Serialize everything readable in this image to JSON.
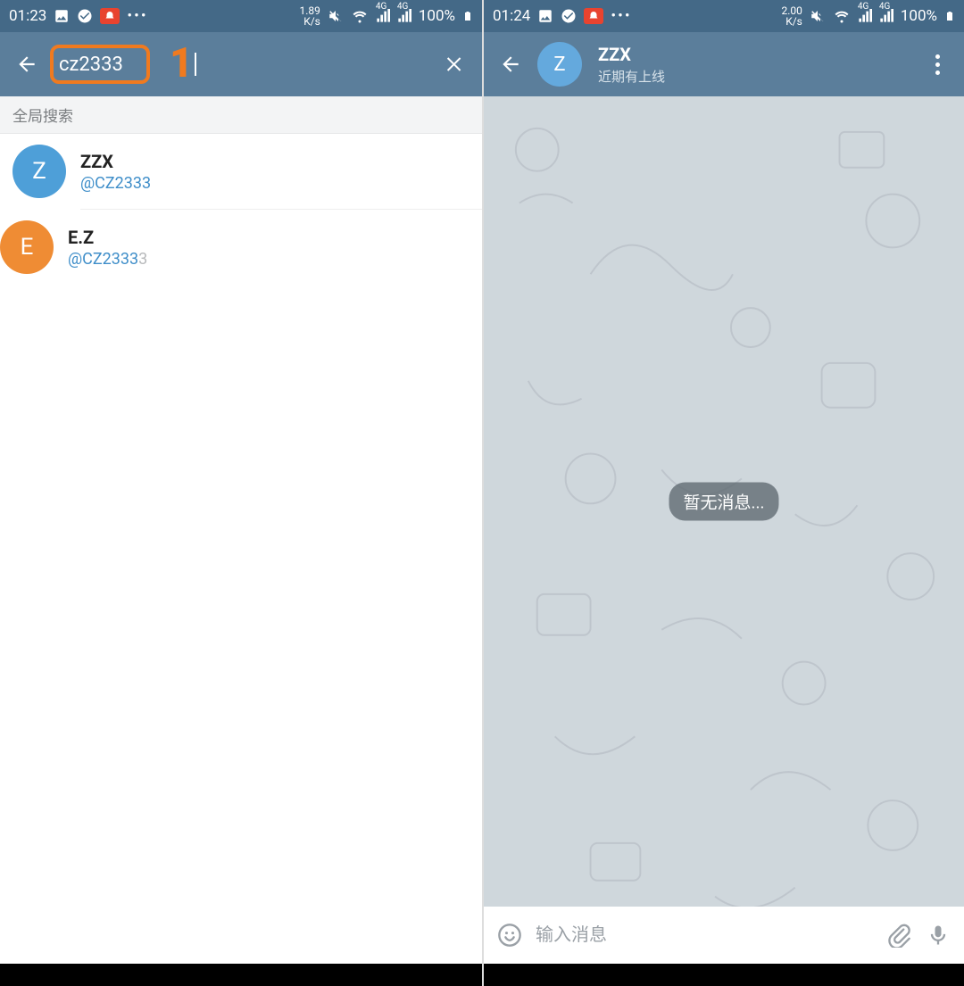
{
  "left": {
    "status": {
      "time": "01:23",
      "net_speed": "1.89",
      "net_unit": "K/s",
      "signal_label_1": "4G",
      "signal_label_2": "4G",
      "battery_pct": "100%"
    },
    "search": {
      "value": "cz2333",
      "annotation": "1"
    },
    "section_header": "全局搜索",
    "results": [
      {
        "avatar_letter": "Z",
        "avatar_color": "blue",
        "name": "ZZX",
        "handle_match": "@CZ2333",
        "handle_rest": ""
      },
      {
        "avatar_letter": "E",
        "avatar_color": "orange",
        "name": "E.Z",
        "handle_match": "@CZ2333",
        "handle_rest": "3"
      }
    ]
  },
  "right": {
    "status": {
      "time": "01:24",
      "net_speed": "2.00",
      "net_unit": "K/s",
      "signal_label_1": "4G",
      "signal_label_2": "4G",
      "battery_pct": "100%"
    },
    "chat": {
      "avatar_letter": "Z",
      "name": "ZZX",
      "status": "近期有上线",
      "empty_label": "暂无消息..."
    },
    "compose": {
      "placeholder": "输入消息"
    }
  }
}
